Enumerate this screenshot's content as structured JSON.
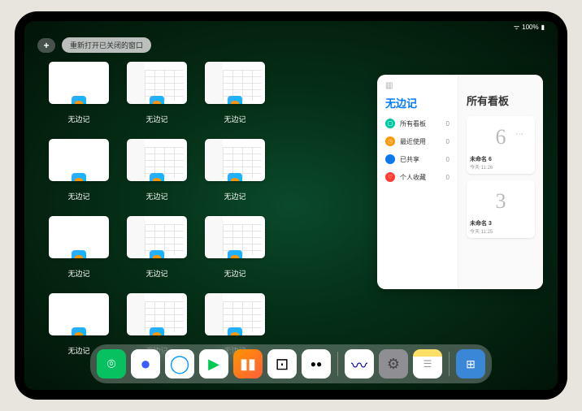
{
  "status": {
    "wifi": "⌃",
    "battery": "100%"
  },
  "controls": {
    "plus": "+",
    "reopen": "重新打开已关闭的窗口"
  },
  "appLabel": "无边记",
  "panel": {
    "leftTitle": "无边记",
    "rightTitle": "所有看板",
    "items": [
      {
        "label": "所有看板",
        "count": "0",
        "color": "#00c7a0"
      },
      {
        "label": "最近使用",
        "count": "0",
        "color": "#ff9500"
      },
      {
        "label": "已共享",
        "count": "0",
        "color": "#007aff"
      },
      {
        "label": "个人收藏",
        "count": "0",
        "color": "#ff3b30"
      }
    ],
    "boards": [
      {
        "glyph": "6",
        "name": "未命名 6",
        "time": "今天 11:26"
      },
      {
        "glyph": "3",
        "name": "未命名 3",
        "time": "今天 11:25"
      }
    ]
  },
  "dock": {
    "apps": [
      {
        "name": "wechat",
        "bg": "#07c160",
        "glyph": "✦"
      },
      {
        "name": "quark",
        "bg": "#fff",
        "glyph": "●"
      },
      {
        "name": "qqbrowser",
        "bg": "#fff",
        "glyph": "◯"
      },
      {
        "name": "migu",
        "bg": "#fff",
        "glyph": "▶"
      },
      {
        "name": "books",
        "bg": "#ff9500",
        "glyph": "▮▮"
      },
      {
        "name": "dice",
        "bg": "#fff",
        "glyph": "⊡"
      },
      {
        "name": "oo",
        "bg": "#fff",
        "glyph": "●●"
      },
      {
        "name": "freeform",
        "bg": "#fff",
        "glyph": "〰"
      },
      {
        "name": "settings",
        "bg": "#8e8e93",
        "glyph": "⚙"
      },
      {
        "name": "notes",
        "bg": "#fff",
        "glyph": "☰"
      }
    ],
    "recent": [
      {
        "name": "folder",
        "bg": "#3a87d8",
        "glyph": "⊞"
      }
    ]
  }
}
